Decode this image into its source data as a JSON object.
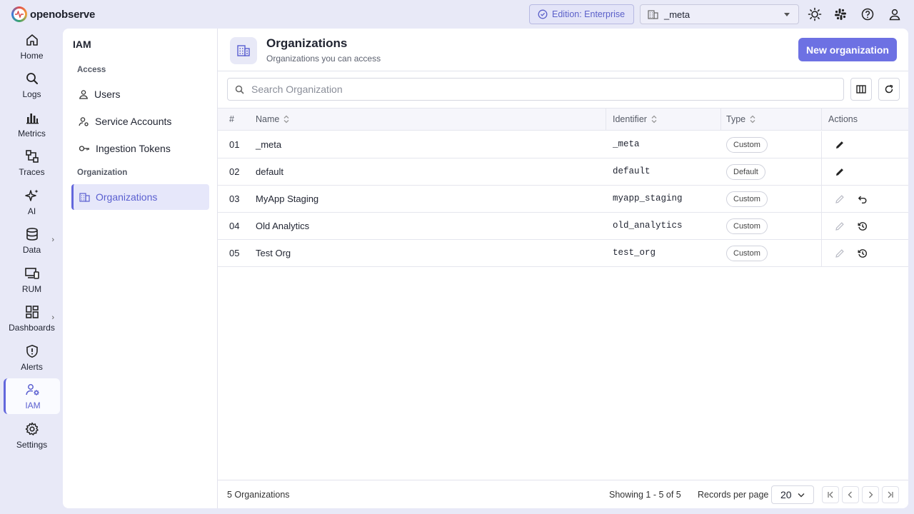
{
  "app": {
    "name": "openobserve"
  },
  "topbar": {
    "edition_label": "Edition: Enterprise",
    "org_selected": "_meta"
  },
  "nav": [
    {
      "label": "Home",
      "icon": "home-icon"
    },
    {
      "label": "Logs",
      "icon": "search-icon"
    },
    {
      "label": "Metrics",
      "icon": "bar-chart-icon"
    },
    {
      "label": "Traces",
      "icon": "traces-icon"
    },
    {
      "label": "AI",
      "icon": "sparkle-icon"
    },
    {
      "label": "Data",
      "icon": "database-icon"
    },
    {
      "label": "RUM",
      "icon": "devices-icon"
    },
    {
      "label": "Dashboards",
      "icon": "dashboard-icon"
    },
    {
      "label": "Alerts",
      "icon": "alert-shield-icon"
    },
    {
      "label": "IAM",
      "icon": "iam-icon",
      "active": true
    },
    {
      "label": "Settings",
      "icon": "gear-icon"
    }
  ],
  "iam": {
    "title": "IAM",
    "group_access": "Access",
    "group_organization": "Organization",
    "items": [
      {
        "label": "Users"
      },
      {
        "label": "Service Accounts"
      },
      {
        "label": "Ingestion Tokens"
      },
      {
        "label": "Organizations",
        "active": true
      }
    ]
  },
  "page": {
    "title": "Organizations",
    "subtitle": "Organizations you can access",
    "new_button": "New organization",
    "search_placeholder": "Search Organization"
  },
  "table": {
    "columns": {
      "num": "#",
      "name": "Name",
      "identifier": "Identifier",
      "type": "Type",
      "actions": "Actions"
    },
    "rows": [
      {
        "num": "01",
        "name": "_meta",
        "identifier": "_meta",
        "type": "Custom",
        "edit_enabled": true,
        "extra_action": ""
      },
      {
        "num": "02",
        "name": "default",
        "identifier": "default",
        "type": "Default",
        "edit_enabled": true,
        "extra_action": ""
      },
      {
        "num": "03",
        "name": "MyApp Staging",
        "identifier": "myapp_staging",
        "type": "Custom",
        "edit_enabled": false,
        "extra_action": "undo-icon"
      },
      {
        "num": "04",
        "name": "Old Analytics",
        "identifier": "old_analytics",
        "type": "Custom",
        "edit_enabled": false,
        "extra_action": "history-icon"
      },
      {
        "num": "05",
        "name": "Test Org",
        "identifier": "test_org",
        "type": "Custom",
        "edit_enabled": false,
        "extra_action": "history-icon"
      }
    ]
  },
  "footer": {
    "count_label": "5 Organizations",
    "showing": "Showing 1 - 5 of 5",
    "rpp_label": "Records per page",
    "rpp_value": "20"
  }
}
